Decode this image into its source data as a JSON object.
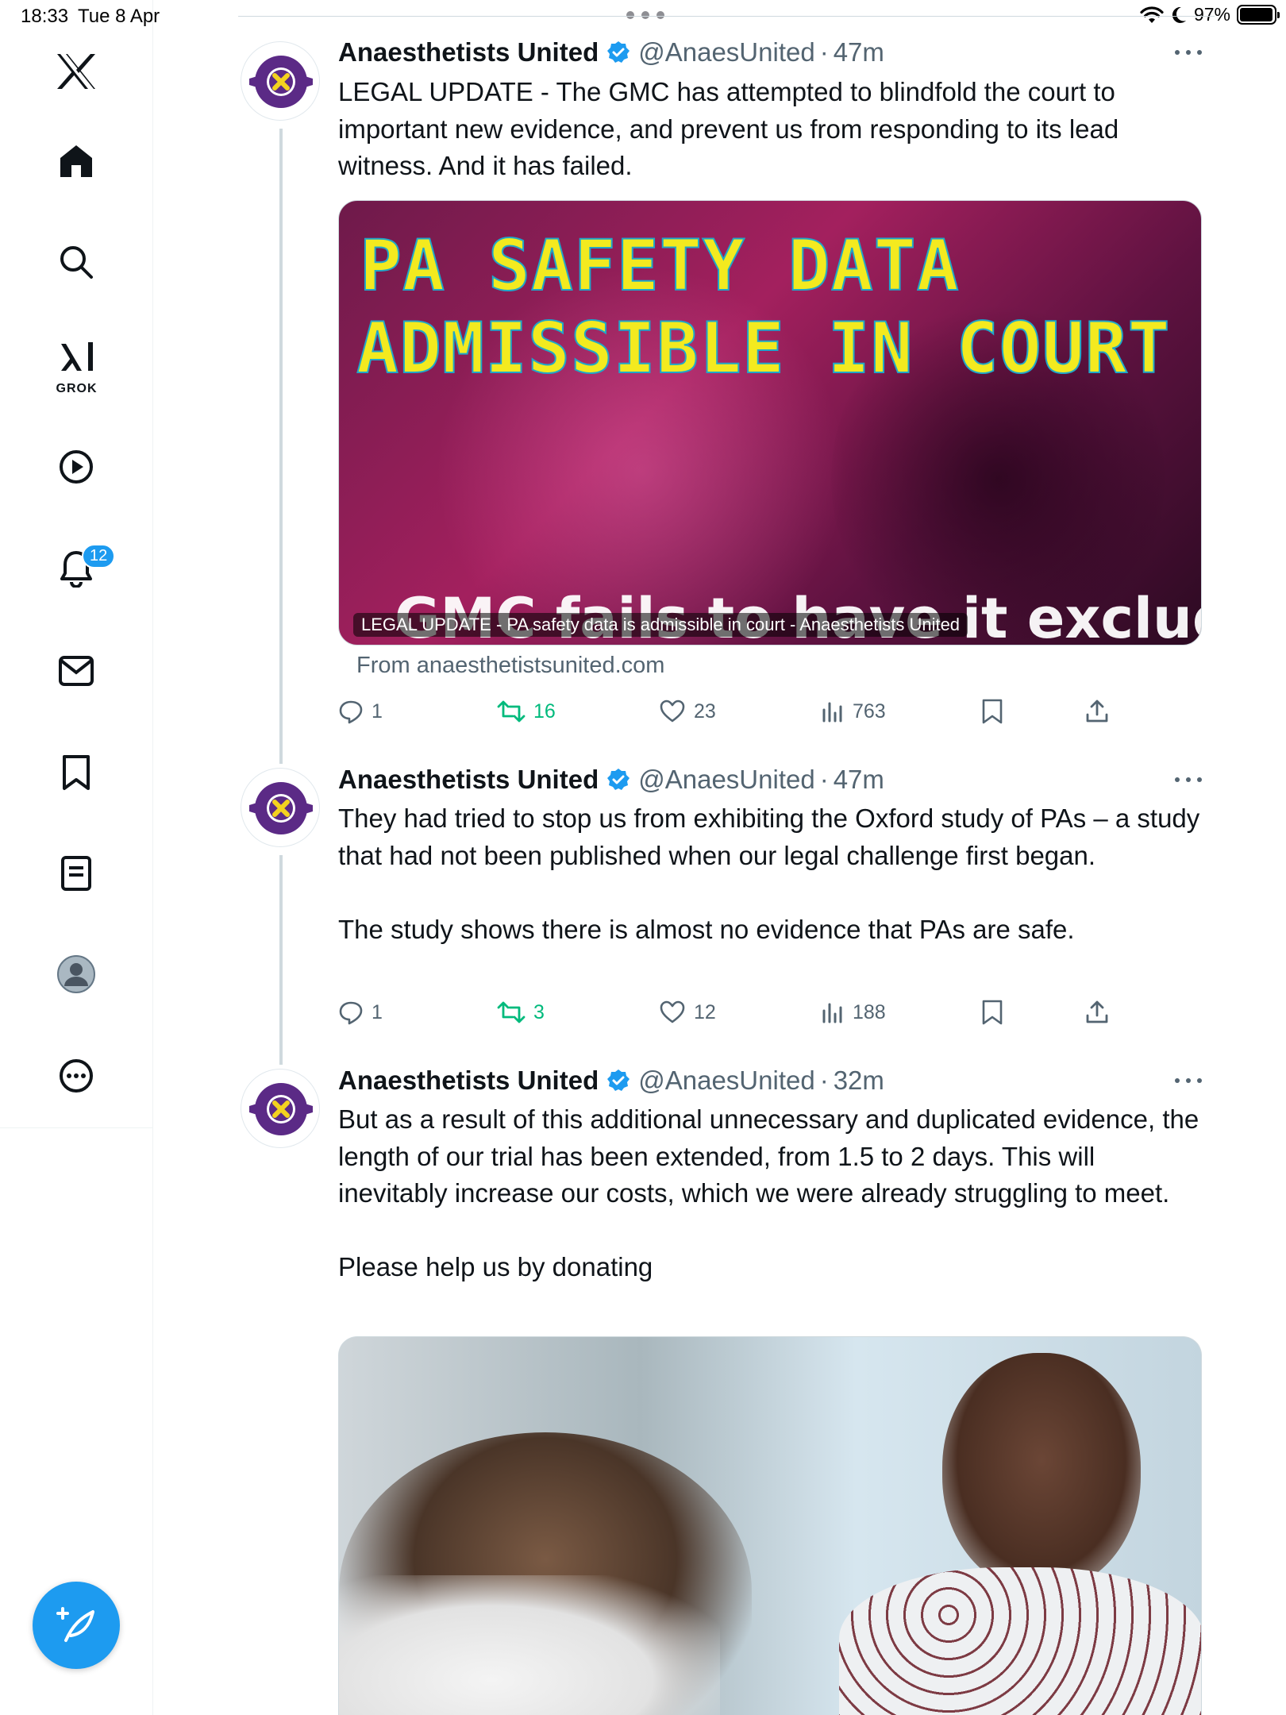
{
  "status_bar": {
    "time": "18:33",
    "date": "Tue 8 Apr",
    "battery": "97%",
    "battery_level": 0.97
  },
  "sidebar": {
    "grok_label": "GROK",
    "notifications_badge": "12",
    "icons": [
      "x-logo-icon",
      "home-icon",
      "search-icon",
      "grok-icon",
      "video-icon",
      "notifications-icon",
      "messages-icon",
      "bookmarks-icon",
      "lists-icon",
      "profile-icon",
      "more-icon"
    ]
  },
  "colors": {
    "accent": "#1d9bf0",
    "retweet_active": "#00ba7c",
    "muted": "#536471",
    "text": "#0f1419"
  },
  "tweets": [
    {
      "name": "Anaesthetists United",
      "handle": "@AnaesUnited",
      "dot": "·",
      "time": "47m",
      "text": "LEGAL UPDATE - The GMC has attempted to blindfold the court to important new evidence, and prevent us from responding to its lead witness. And it has failed.",
      "card": {
        "headline_1": "PA SAFETY DATA",
        "headline_2": "ADMISSIBLE IN COURT",
        "subline": "GMC fails to have it excluded",
        "caption": "LEGAL UPDATE - PA safety data is admissible in court - Anaesthetists United",
        "from": "From anaesthetistsunited.com"
      },
      "replies": "1",
      "retweets": "16",
      "likes": "23",
      "views": "763"
    },
    {
      "name": "Anaesthetists United",
      "handle": "@AnaesUnited",
      "dot": "·",
      "time": "47m",
      "text": "They had tried to stop us from exhibiting the Oxford study of PAs – a study that had not been published when our legal challenge first began.\n\nThe study shows there is almost no evidence that PAs are safe.",
      "replies": "1",
      "retweets": "3",
      "likes": "12",
      "views": "188"
    },
    {
      "name": "Anaesthetists United",
      "handle": "@AnaesUnited",
      "dot": "·",
      "time": "32m",
      "text": "But as a result of this additional unnecessary and duplicated evidence, the length of our trial has been extended, from 1.5 to 2 days. This will inevitably increase our costs, which we were already struggling to meet.\n\nPlease help us by donating"
    }
  ]
}
